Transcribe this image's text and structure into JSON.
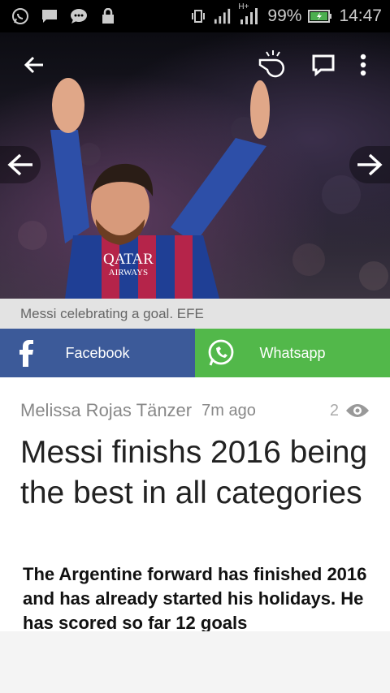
{
  "status_bar": {
    "network": "H+",
    "battery": "99%",
    "time": "14:47",
    "icons": [
      "whatsapp-icon",
      "message-icon",
      "chat-bubble-icon",
      "lock-icon",
      "vibrate-icon",
      "signal-icon",
      "signal-h-icon",
      "battery-charging-icon"
    ]
  },
  "toolbar": {
    "icons": [
      "back-arrow-icon",
      "whistle-icon",
      "comment-icon",
      "more-vert-icon"
    ]
  },
  "gallery": {
    "prev_icon": "arrow-left-icon",
    "next_icon": "arrow-right-icon",
    "caption": "Messi celebrating a goal. EFE",
    "jersey_sponsor_line1": "QATAR",
    "jersey_sponsor_line2": "AIRWAYS"
  },
  "share": {
    "facebook_label": "Facebook",
    "whatsapp_label": "Whatsapp"
  },
  "article": {
    "author": "Melissa Rojas Tänzer",
    "time_ago": "7m ago",
    "views": "2",
    "headline": "Messi finishs 2016 being the best in all categories",
    "lead": "The Argentine forward has finished 2016 and has already started his holidays. He has scored so far 12 goals"
  },
  "colors": {
    "facebook": "#3c5a99",
    "whatsapp": "#52b84a",
    "status_bar": "#000000"
  }
}
